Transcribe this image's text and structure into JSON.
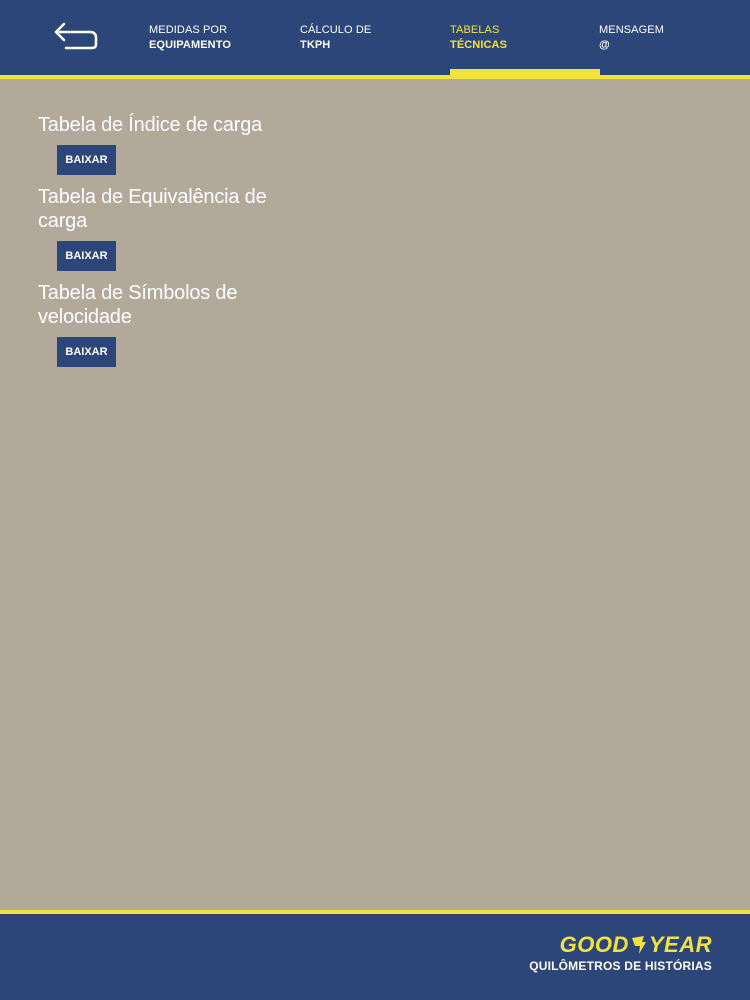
{
  "header": {
    "tabs": [
      {
        "line1": "MEDIDAS POR",
        "line2": "EQUIPAMENTO"
      },
      {
        "line1": "CÁLCULO DE",
        "line2": "TKPH"
      },
      {
        "line1": "TABELAS",
        "line2": "TÉCNICAS"
      },
      {
        "line1": "MENSAGEM",
        "line2": "@"
      }
    ],
    "active_tab": "TABELAS TÉCNICAS"
  },
  "tables": [
    {
      "title": "Tabela de Índice de carga",
      "button": "BAIXAR"
    },
    {
      "title": "Tabela de Equivalência de carga",
      "button": "BAIXAR"
    },
    {
      "title": "Tabela de Símbolos de velocidade",
      "button": "BAIXAR"
    }
  ],
  "footer": {
    "logo_left": "GOOD",
    "logo_right": "YEAR",
    "tagline": "QUILÔMETROS DE HISTÓRIAS"
  },
  "colors": {
    "header_bg": "#2c4679",
    "accent": "#f4e23c",
    "content_bg": "#b2a99b"
  },
  "icons": {
    "back": "back-arrow-icon",
    "logo_mark": "winged-foot-icon"
  }
}
